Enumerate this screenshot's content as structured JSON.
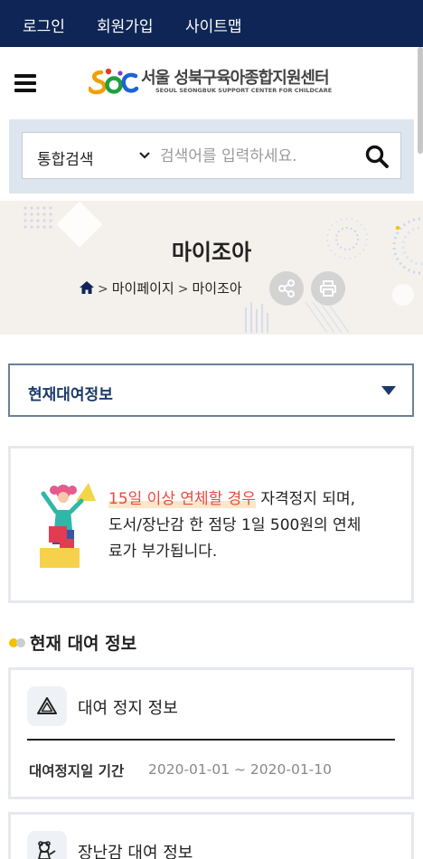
{
  "topbar": {
    "login": "로그인",
    "signup": "회원가입",
    "sitemap": "사이트맵"
  },
  "header": {
    "menu_icon": "hamburger-icon",
    "logo_name": "서울 성북구육아종합지원센터",
    "logo_sub": "SEOUL SEONGBUK SUPPORT CENTER FOR CHILDCARE"
  },
  "search": {
    "category": "통합검색",
    "placeholder": "검색어를 입력하세요.",
    "button_icon": "search-icon"
  },
  "hero": {
    "title": "마이조아",
    "breadcrumb": [
      "마이페이지",
      "마이조아"
    ],
    "share_icon": "share-icon",
    "print_icon": "print-icon"
  },
  "accordion": {
    "label": "현재대여정보"
  },
  "notice": {
    "highlight": "15일 이상 연체할 경우",
    "line1_rest": " 자격정지 되며,",
    "line2": "도서/장난감 한 점당 1일 500원의 연체",
    "line3": "료가 부가됩니다."
  },
  "section": {
    "title": "현재 대여 정보"
  },
  "cards": [
    {
      "title": "대여 정지 정보",
      "icon": "warning-triangle-icon",
      "row_label": "대여정지일 기간",
      "row_value": "2020-01-01 ~ 2020-01-10"
    },
    {
      "title": "장난감 대여 정보",
      "icon": "toy-icon"
    }
  ],
  "colors": {
    "navy": "#0f2556",
    "accent_red": "#e84a3f",
    "border": "#e5e8ee",
    "dot_yellow": "#f2c200",
    "dot_gray": "#c9ccd1"
  }
}
